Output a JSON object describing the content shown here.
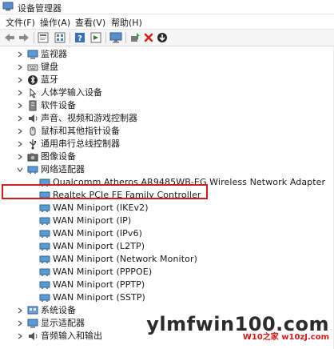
{
  "window": {
    "title": "设备管理器"
  },
  "menu": [
    {
      "label": "文件(F)"
    },
    {
      "label": "操作(A)"
    },
    {
      "label": "查看(V)"
    },
    {
      "label": "帮助(H)"
    }
  ],
  "toolbar": [
    "back-arrow-icon",
    "forward-arrow-icon",
    "properties-icon",
    "list-view-icon",
    "help-icon",
    "action-view-icon",
    "monitor-icon",
    "update-driver-icon",
    "uninstall-x-icon",
    "download-driver-icon"
  ],
  "tree": {
    "categories_top": [
      {
        "label": "监视器",
        "icon": "monitor-icon"
      },
      {
        "label": "键盘",
        "icon": "keyboard-icon"
      },
      {
        "label": "蓝牙",
        "icon": "bluetooth-icon"
      },
      {
        "label": "人体学输入设备",
        "icon": "hid-icon"
      },
      {
        "label": "软件设备",
        "icon": "software-device-icon"
      },
      {
        "label": "声音、视频和游戏控制器",
        "icon": "speaker-icon"
      },
      {
        "label": "鼠标和其他指针设备",
        "icon": "mouse-icon"
      },
      {
        "label": "通用串行总线控制器",
        "icon": "usb-icon"
      },
      {
        "label": "图像设备",
        "icon": "camera-icon"
      }
    ],
    "network": {
      "label": "网络适配器",
      "children": [
        {
          "label": "Qualcomm Atheros AR9485WB-EG Wireless Network Adapter"
        },
        {
          "label": "Realtek PCIe FE Family Controller"
        },
        {
          "label": "WAN Miniport (IKEv2)"
        },
        {
          "label": "WAN Miniport (IP)"
        },
        {
          "label": "WAN Miniport (IPv6)"
        },
        {
          "label": "WAN Miniport (L2TP)"
        },
        {
          "label": "WAN Miniport (Network Monitor)"
        },
        {
          "label": "WAN Miniport (PPPOE)"
        },
        {
          "label": "WAN Miniport (PPTP)"
        },
        {
          "label": "WAN Miniport (SSTP)"
        }
      ]
    },
    "categories_bottom": [
      {
        "label": "系统设备",
        "icon": "system-device-icon"
      },
      {
        "label": "显示适配器",
        "icon": "display-adapter-icon"
      },
      {
        "label": "音频输入和输出",
        "icon": "audio-io-icon"
      }
    ]
  },
  "highlight_color": "#c8201e",
  "watermark": {
    "main": "ylmfwin100.com",
    "sub": "W10之家 w10zJ.com"
  }
}
